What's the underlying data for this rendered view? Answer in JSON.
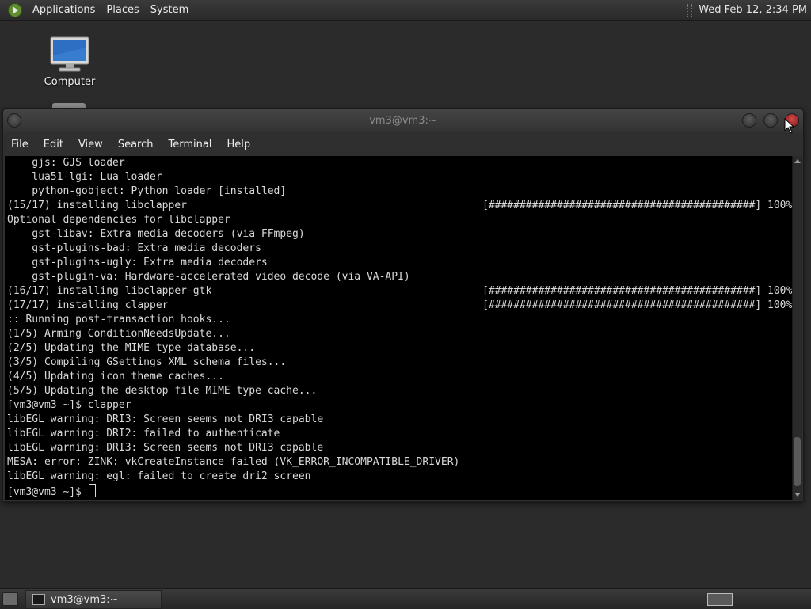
{
  "top_panel": {
    "menus": [
      "Applications",
      "Places",
      "System"
    ],
    "clock": "Wed Feb 12,  2:34 PM"
  },
  "desktop": {
    "icons": [
      {
        "label": "Computer",
        "icon": "computer-icon"
      }
    ]
  },
  "terminal": {
    "title": "vm3@vm3:~",
    "menu": [
      "File",
      "Edit",
      "View",
      "Search",
      "Terminal",
      "Help"
    ],
    "lines": [
      {
        "text": "    gjs: GJS loader",
        "progress": ""
      },
      {
        "text": "    lua51-lgi: Lua loader",
        "progress": ""
      },
      {
        "text": "    python-gobject: Python loader [installed]",
        "progress": ""
      },
      {
        "text": "(15/17) installing libclapper",
        "progress": "[###########################################] 100%"
      },
      {
        "text": "Optional dependencies for libclapper",
        "progress": ""
      },
      {
        "text": "    gst-libav: Extra media decoders (via FFmpeg)",
        "progress": ""
      },
      {
        "text": "    gst-plugins-bad: Extra media decoders",
        "progress": ""
      },
      {
        "text": "    gst-plugins-ugly: Extra media decoders",
        "progress": ""
      },
      {
        "text": "    gst-plugin-va: Hardware-accelerated video decode (via VA-API)",
        "progress": ""
      },
      {
        "text": "(16/17) installing libclapper-gtk",
        "progress": "[###########################################] 100%"
      },
      {
        "text": "(17/17) installing clapper",
        "progress": "[###########################################] 100%"
      },
      {
        "text": ":: Running post-transaction hooks...",
        "progress": ""
      },
      {
        "text": "(1/5) Arming ConditionNeedsUpdate...",
        "progress": ""
      },
      {
        "text": "(2/5) Updating the MIME type database...",
        "progress": ""
      },
      {
        "text": "(3/5) Compiling GSettings XML schema files...",
        "progress": ""
      },
      {
        "text": "(4/5) Updating icon theme caches...",
        "progress": ""
      },
      {
        "text": "(5/5) Updating the desktop file MIME type cache...",
        "progress": ""
      },
      {
        "text": "[vm3@vm3 ~]$ clapper",
        "progress": ""
      },
      {
        "text": "libEGL warning: DRI3: Screen seems not DRI3 capable",
        "progress": ""
      },
      {
        "text": "libEGL warning: DRI2: failed to authenticate",
        "progress": ""
      },
      {
        "text": "libEGL warning: DRI3: Screen seems not DRI3 capable",
        "progress": ""
      },
      {
        "text": "MESA: error: ZINK: vkCreateInstance failed (VK_ERROR_INCOMPATIBLE_DRIVER)",
        "progress": ""
      },
      {
        "text": "libEGL warning: egl: failed to create dri2 screen",
        "progress": ""
      }
    ],
    "prompt": "[vm3@vm3 ~]$ "
  },
  "bottom_panel": {
    "task_label": "vm3@vm3:~"
  }
}
